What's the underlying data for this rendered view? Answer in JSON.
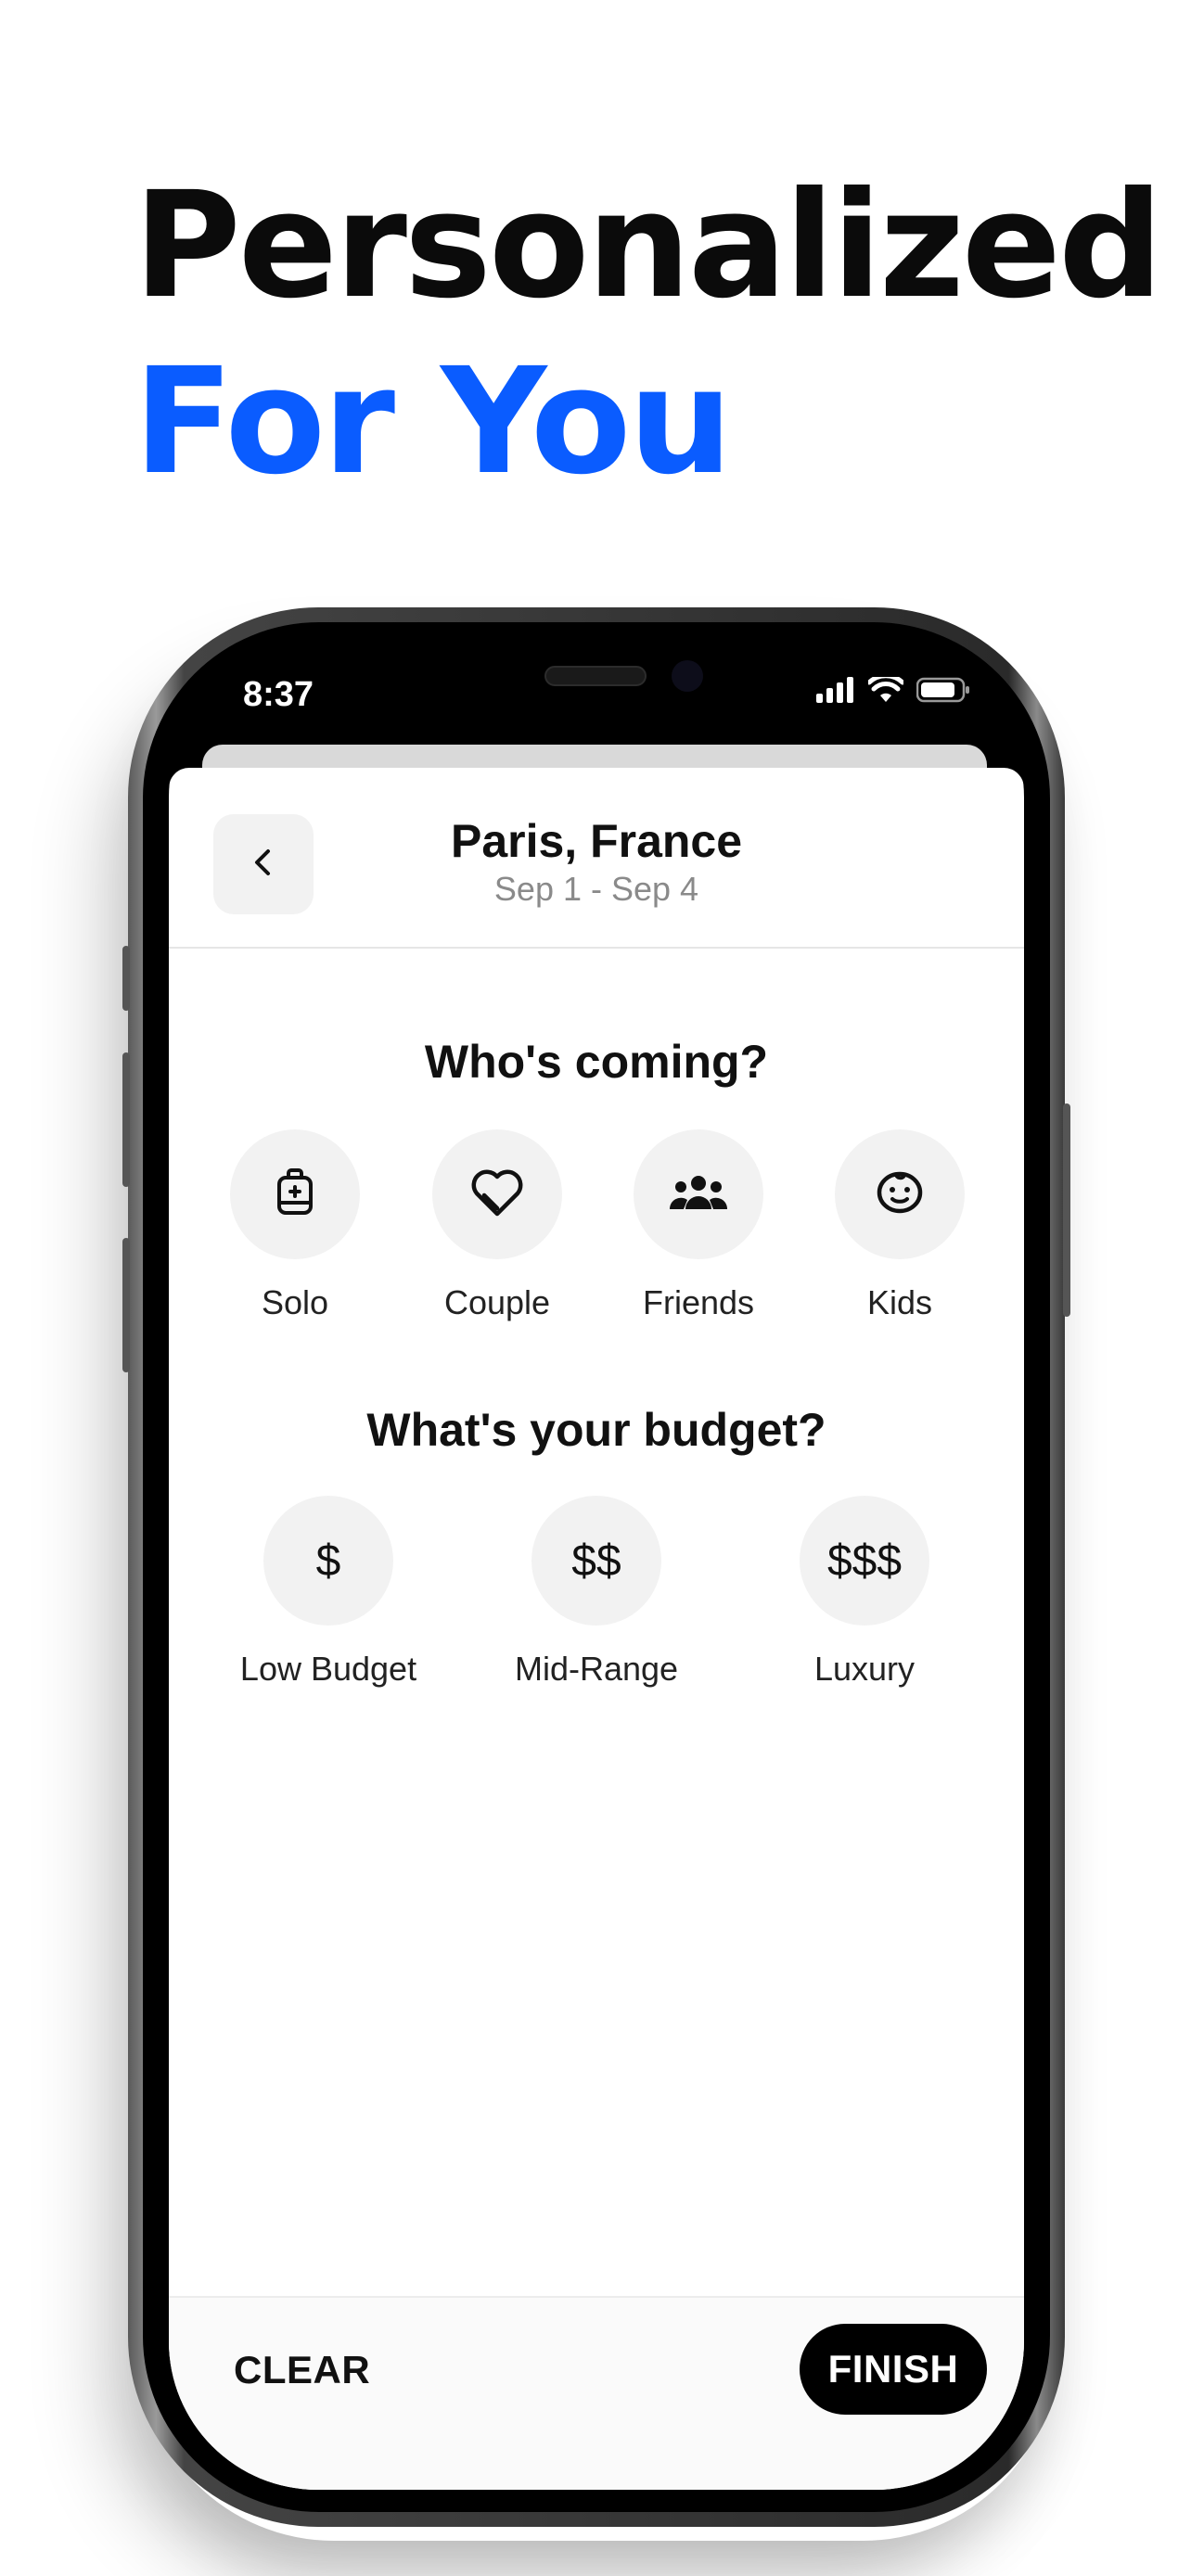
{
  "headline": {
    "line1": "Personalized",
    "line2": "For You",
    "line2_color": "#0a5cff"
  },
  "status_bar": {
    "time": "8:37",
    "icons": [
      "signal-icon",
      "wifi-icon",
      "battery-icon"
    ]
  },
  "header": {
    "back_icon": "chevron-left-icon",
    "title": "Paris, France",
    "dates": "Sep 1 - Sep 4"
  },
  "companions": {
    "title": "Who's coming?",
    "options": [
      {
        "label": "Solo",
        "icon": "backpack-icon"
      },
      {
        "label": "Couple",
        "icon": "heart-icon"
      },
      {
        "label": "Friends",
        "icon": "group-icon"
      },
      {
        "label": "Kids",
        "icon": "baby-face-icon"
      }
    ]
  },
  "budget": {
    "title": "What's your budget?",
    "options": [
      {
        "symbol": "$",
        "label": "Low Budget"
      },
      {
        "symbol": "$$",
        "label": "Mid-Range"
      },
      {
        "symbol": "$$$",
        "label": "Luxury"
      }
    ]
  },
  "footer": {
    "clear_label": "CLEAR",
    "finish_label": "FINISH"
  }
}
